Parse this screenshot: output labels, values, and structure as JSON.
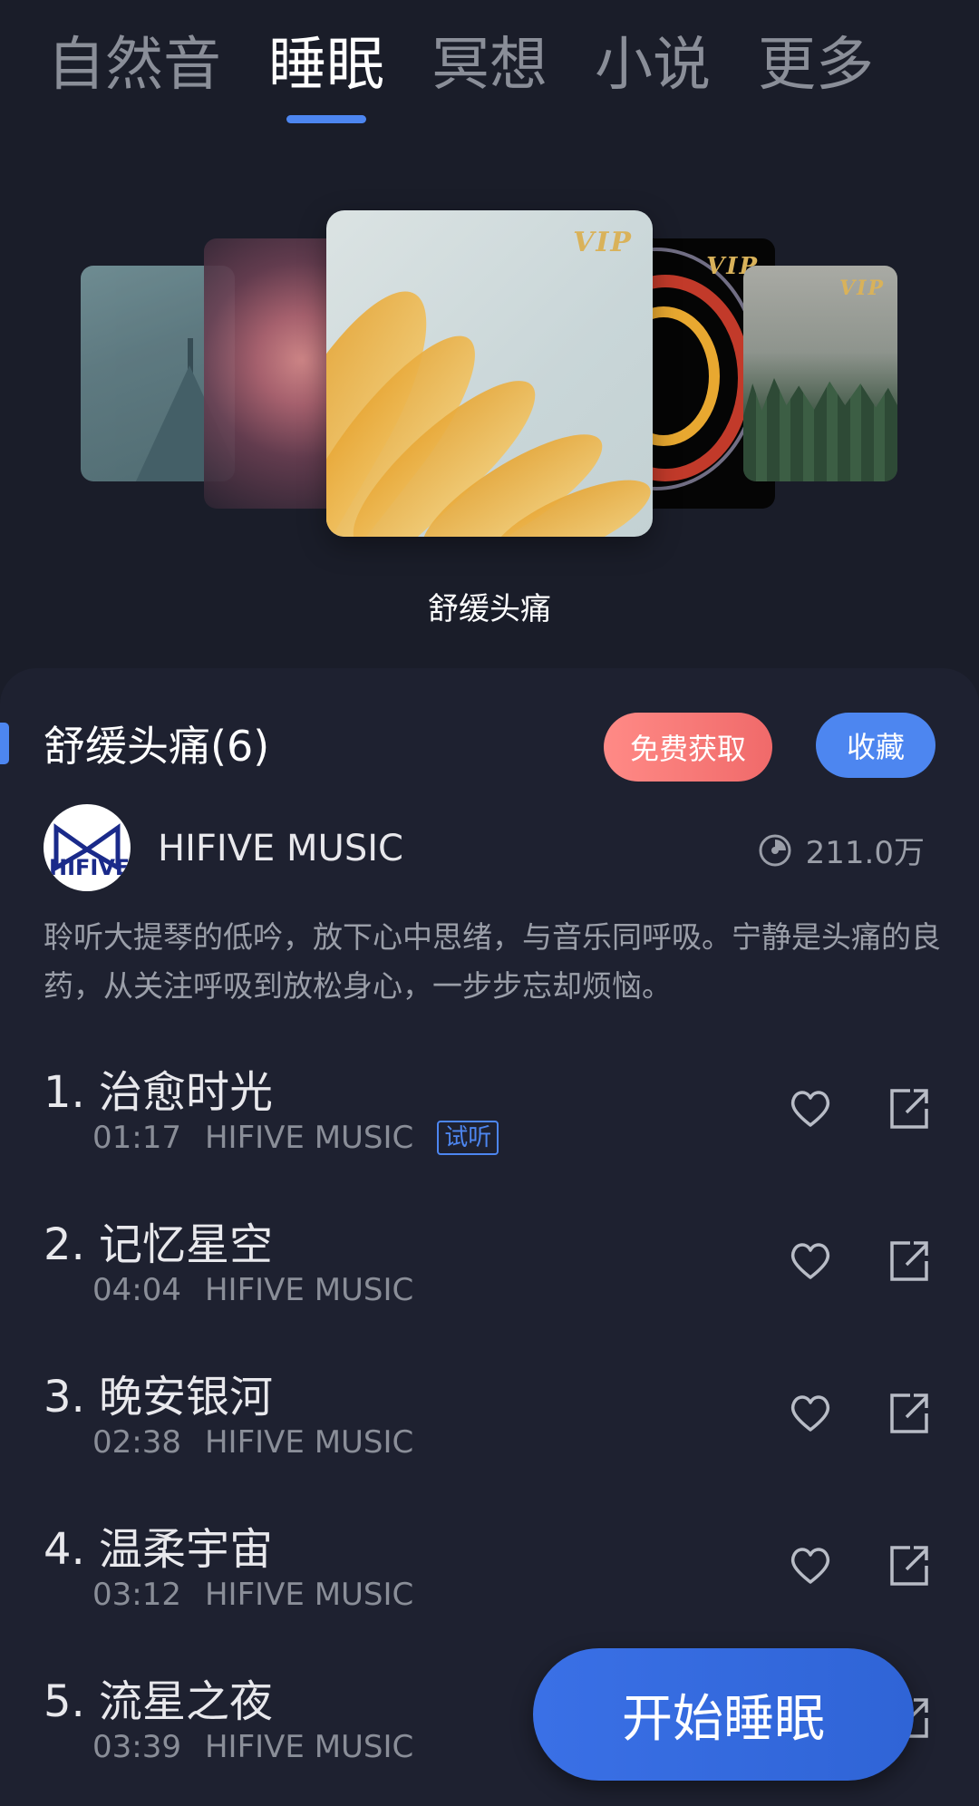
{
  "tabs": [
    {
      "label": "自然音"
    },
    {
      "label": "睡眠"
    },
    {
      "label": "冥想"
    },
    {
      "label": "小说"
    },
    {
      "label": "更多"
    }
  ],
  "carousel": {
    "vip_label": "VIP",
    "caption": "舒缓头痛"
  },
  "playlist": {
    "title": "舒缓头痛(6)",
    "free_button": "免费获取",
    "favorite_button": "收藏",
    "avatar_text": "HIFIVE",
    "author": "HIFIVE MUSIC",
    "play_count": "211.0万",
    "description": "聆听大提琴的低吟，放下心中思绪，与音乐同呼吸。宁静是头痛的良药，从关注呼吸到放松身心，一步步忘却烦恼。"
  },
  "tracks": [
    {
      "title": "1. 治愈时光",
      "duration": "01:17",
      "artist": "HIFIVE MUSIC",
      "tag": "试听"
    },
    {
      "title": "2. 记忆星空",
      "duration": "04:04",
      "artist": "HIFIVE MUSIC"
    },
    {
      "title": "3. 晚安银河",
      "duration": "02:38",
      "artist": "HIFIVE MUSIC"
    },
    {
      "title": "4. 温柔宇宙",
      "duration": "03:12",
      "artist": "HIFIVE MUSIC"
    },
    {
      "title": "5. 流星之夜",
      "duration": "03:39",
      "artist": "HIFIVE MUSIC"
    }
  ],
  "start_button": "开始睡眠",
  "colors": {
    "background": "#1a1d29",
    "accent": "#4d86f0",
    "free_button": "#f06a6a",
    "vip_gold": "#d9b25a"
  }
}
